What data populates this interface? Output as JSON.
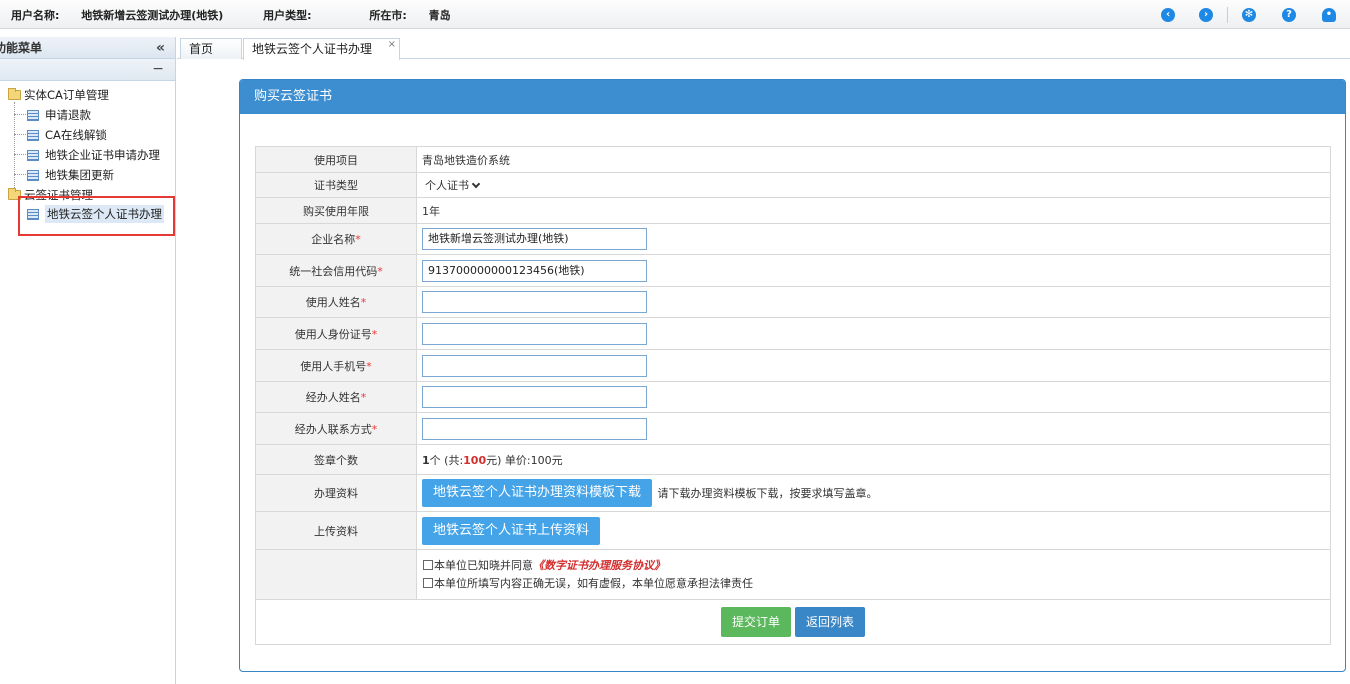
{
  "header": {
    "user_name_label": "用户名称:",
    "user_name": "地铁新增云签测试办理(地铁)",
    "user_type_label": "用户类型:",
    "user_type": "",
    "city_label": "所在市:",
    "city": "青岛",
    "icons": [
      "back-icon",
      "forward-icon",
      "settings-icon",
      "help-icon",
      "bell-icon"
    ]
  },
  "sidebar": {
    "title": "功能菜单",
    "collapse_label": "«",
    "minus_label": "−",
    "groups": [
      {
        "label": "实体CA订单管理",
        "items": [
          "申请退款",
          "CA在线解锁",
          "地铁企业证书申请办理",
          "地铁集团更新"
        ]
      },
      {
        "label": "云签证书管理",
        "items": [
          "地铁云签个人证书办理"
        ]
      }
    ]
  },
  "tabs": [
    {
      "label": "首页"
    },
    {
      "label": "地铁云签个人证书办理",
      "close": "×"
    }
  ],
  "panel": {
    "title": "购买云签证书"
  },
  "form": {
    "project_label": "使用项目",
    "project_value": "青岛地铁造价系统",
    "cert_type_label": "证书类型",
    "cert_type_value": "个人证书",
    "years_label": "购买使用年限",
    "years_value": "1年",
    "company_label": "企业名称",
    "company_value": "地铁新增云签测试办理(地铁)",
    "credit_code_label": "统一社会信用代码",
    "credit_code_value": "913700000000123456(地铁)",
    "user_name_label": "使用人姓名",
    "user_id_label": "使用人身份证号",
    "user_phone_label": "使用人手机号",
    "agent_name_label": "经办人姓名",
    "agent_contact_label": "经办人联系方式",
    "required_mark": "*",
    "seal_count_label": "签章个数",
    "seal_count": "1",
    "seal_unit": "个 (共:",
    "seal_total": "100",
    "seal_price": "元) 单价:100元",
    "materials_label": "办理资料",
    "download_button": "地铁云签个人证书办理资料模板下载",
    "download_hint": "请下载办理资料模板下载，按要求填写盖章。",
    "upload_label": "上传资料",
    "upload_button": "地铁云签个人证书上传资料",
    "agree1_text": "本单位已知晓并同意",
    "agree1_link": "《数字证书办理服务协议》",
    "agree2_text": "本单位所填写内容正确无误，如有虚假，本单位愿意承担法律责任"
  },
  "actions": {
    "submit": "提交订单",
    "back": "返回列表"
  },
  "colors": {
    "panel_header": "#3d8ed0",
    "primary_button": "#45a4e8",
    "submit_button": "#5cb85c",
    "back_button": "#3a87c8",
    "required": "#e53935",
    "highlight": "#e53935"
  }
}
